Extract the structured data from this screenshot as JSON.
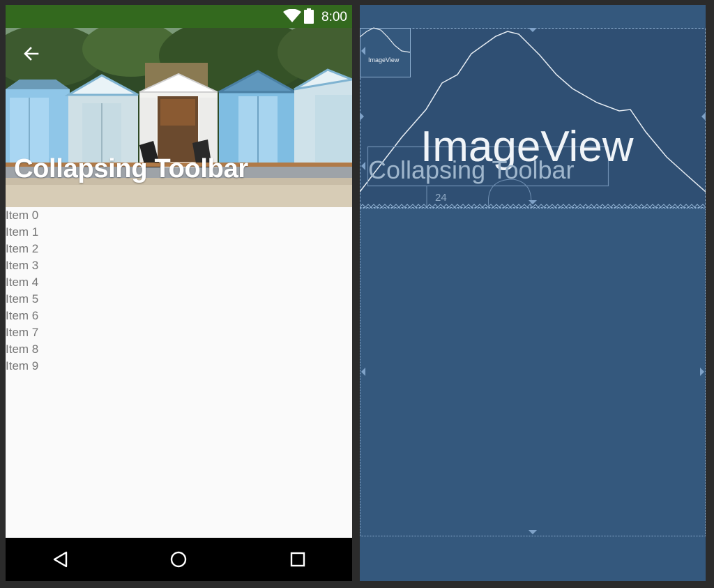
{
  "device": {
    "status_bar": {
      "time": "8:00",
      "color": "#33691e"
    },
    "toolbar": {
      "title": "Collapsing Toolbar",
      "back_icon": "arrow-back-icon"
    },
    "items": [
      "Item 0",
      "Item 1",
      "Item 2",
      "Item 3",
      "Item 4",
      "Item 5",
      "Item 6",
      "Item 7",
      "Item 8",
      "Item 9"
    ],
    "nav_bar": {
      "back": "back-triangle-icon",
      "home": "home-circle-icon",
      "recents": "recents-square-icon"
    }
  },
  "blueprint": {
    "image_view_label": "ImageView",
    "toolbar_label": "Collapsing Toolbar",
    "small_image_view_label": "ImageView",
    "margin_label": "24",
    "background": "#34587d"
  }
}
